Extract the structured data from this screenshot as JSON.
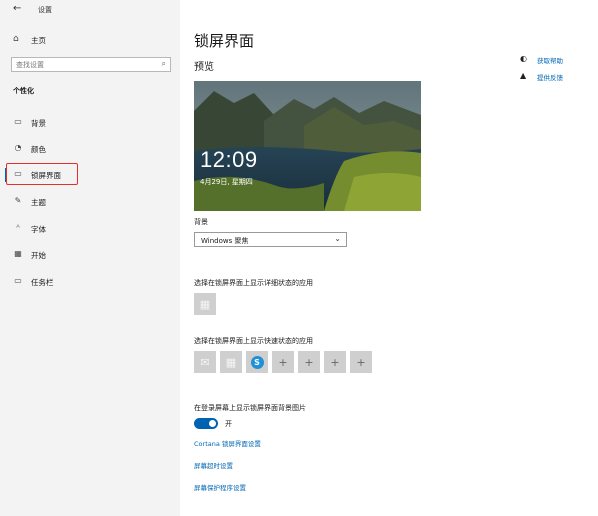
{
  "window": {
    "title": "设置"
  },
  "sidebar": {
    "back_icon": "back-arrow-icon",
    "home_label": "主页",
    "search_placeholder": "查找设置",
    "section_title": "个性化",
    "items": [
      {
        "label": "背景",
        "icon": "image-icon",
        "active": false
      },
      {
        "label": "颜色",
        "icon": "palette-icon",
        "active": false
      },
      {
        "label": "锁屏界面",
        "icon": "lock-screen-icon",
        "active": true
      },
      {
        "label": "主题",
        "icon": "brush-icon",
        "active": false
      },
      {
        "label": "字体",
        "icon": "font-icon",
        "active": false
      },
      {
        "label": "开始",
        "icon": "start-icon",
        "active": false
      },
      {
        "label": "任务栏",
        "icon": "taskbar-icon",
        "active": false
      }
    ]
  },
  "main": {
    "title": "锁屏界面",
    "preview_label": "预览",
    "preview": {
      "time": "12:09",
      "date": "4月29日, 星期四"
    },
    "help_links": [
      {
        "label": "获取帮助",
        "icon": "help-chat-icon"
      },
      {
        "label": "提供反馈",
        "icon": "feedback-icon"
      }
    ],
    "background_label": "背景",
    "background_value": "Windows 聚焦",
    "detail_status_label": "选择在锁屏界面上显示详细状态的应用",
    "quick_status_label": "选择在锁屏界面上显示快速状态的应用",
    "quick_apps": [
      {
        "icon": "mail-icon",
        "glyph": "✉"
      },
      {
        "icon": "calendar-icon",
        "glyph": "▦"
      },
      {
        "icon": "skype-icon",
        "glyph": "S"
      },
      {
        "icon": "add-icon",
        "glyph": "+"
      },
      {
        "icon": "add-icon",
        "glyph": "+"
      },
      {
        "icon": "add-icon",
        "glyph": "+"
      },
      {
        "icon": "add-icon",
        "glyph": "+"
      }
    ],
    "lock_bg_label": "在登录屏幕上显示锁屏界面背景图片",
    "toggle_state": "开",
    "links": [
      "Cortana 锁屏界面设置",
      "屏幕超时设置",
      "屏幕保护程序设置"
    ]
  },
  "colors": {
    "accent": "#0063b1",
    "link": "#0066b4",
    "highlight_box": "#e53030"
  }
}
